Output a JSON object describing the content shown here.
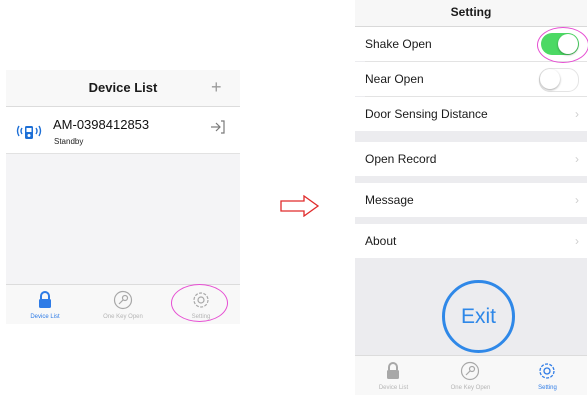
{
  "device_list": {
    "title": "Device List",
    "add_icon": "plus-icon",
    "device": {
      "name": "AM-0398412853",
      "status": "Standby",
      "icon": "bluetooth-lock-icon",
      "action_icon": "enter-icon"
    }
  },
  "tabs": [
    {
      "label": "Device List",
      "icon": "lock-icon"
    },
    {
      "label": "One Key Open",
      "icon": "key-icon"
    },
    {
      "label": "Setting",
      "icon": "gear-icon"
    }
  ],
  "settings": {
    "title": "Setting",
    "rows": [
      {
        "label": "Shake Open",
        "toggle": true
      },
      {
        "label": "Near Open",
        "toggle": false
      },
      {
        "label": "Door Sensing Distance"
      },
      {
        "label": "Open Record"
      },
      {
        "label": "Message"
      },
      {
        "label": "About"
      }
    ],
    "chevron": "›",
    "exit_label": "Exit"
  },
  "colors": {
    "accent": "#2f88e8",
    "toggle_on": "#4cd964",
    "highlight": "#e64fd3",
    "arrow": "#e02b2b"
  }
}
